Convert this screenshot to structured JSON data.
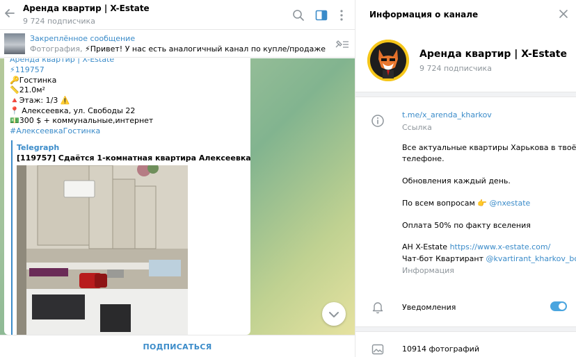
{
  "chat": {
    "title": "Аренда квартир | X-Estate",
    "subscribers": "9 724 подписчика",
    "pinned": {
      "title": "Закреплённое сообщение",
      "prefix": "Фотография, ",
      "text": "⚡Привет! У нас есть аналогичный канал по купле/продаже квар..."
    },
    "message": {
      "channel_name": "Аренда квартир | X-Estate",
      "id_line": "⚡119757",
      "type_line": "🔑Гостинка",
      "area_line": "📏21.0м²",
      "floor_line": "🔺Этаж: 1/3 ⚠️",
      "address_line": "📍 Алексеевка, ул. Свободы 22",
      "price_line": "💵300 $ + коммунальные,интернет",
      "hashtag": "#АлексеевкаГостинка",
      "preview_site": "Telegraph",
      "preview_title": "[119757] Сдаётся 1-комнатная квартира Алексеевка"
    },
    "subscribe_label": "ПОДПИСАТЬСЯ"
  },
  "info_panel": {
    "header": "Информация о канале",
    "name": "Аренда квартир | X-Estate",
    "subscribers": "9 724 подписчика",
    "link": "t.me/x_arenda_kharkov",
    "link_label": "Ссылка",
    "desc_line1": "Все актуальные квартиры Харькова в твоём",
    "desc_line2": "телефоне.",
    "desc_line3": "Обновления каждый день.",
    "desc_line4_prefix": "По всем вопросам 👉 ",
    "desc_line4_link": "@nxestate",
    "desc_line5": "Оплата 50% по факту вселения",
    "desc_line6_prefix": "АН X-Estate ",
    "desc_line6_link": "https://www.x-estate.com/",
    "desc_line7_prefix": "Чат-бот Квартирант ",
    "desc_line7_link": "@kvartirant_kharkov_bot",
    "info_label": "Информация",
    "notifications_label": "Уведомления",
    "notifications_on": true,
    "photos_label": "10914 фотографий"
  },
  "colors": {
    "accent": "#3a8bc9",
    "toggle": "#4aa5df",
    "muted": "#8e959b"
  }
}
